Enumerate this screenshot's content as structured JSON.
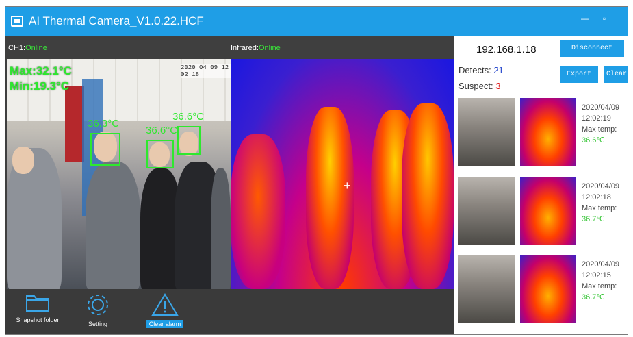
{
  "window": {
    "title": "AI Thermal Camera_V1.0.22.HCF",
    "minimize": "—",
    "maximize": "▫"
  },
  "channels": {
    "ch1_label": "CH1:",
    "ch1_status": "Online",
    "ir_label": "Infrared:",
    "ir_status": "Online"
  },
  "camera": {
    "max_label": "Max:32.1°C",
    "min_label": "Min:19.3°C",
    "timestamp": "2020 04 09 12 02 18",
    "detections": [
      "36.3°C",
      "36.6°C",
      "36.6°C"
    ]
  },
  "toolbar": {
    "snapshot_folder": "Snapshot folder",
    "setting": "Setting",
    "clear_alarm": "Clear alarm"
  },
  "panel": {
    "ip": "192.168.1.18",
    "disconnect": "Disconnect",
    "export": "Export",
    "clear": "Clear",
    "detects_label": "Detects: ",
    "detects_value": "21",
    "suspect_label": "Suspect: ",
    "suspect_value": "3"
  },
  "records": [
    {
      "date": "2020/04/09",
      "time": "12:02:19",
      "label": "Max temp:",
      "temp": "36.6℃"
    },
    {
      "date": "2020/04/09",
      "time": "12:02:18",
      "label": "Max temp:",
      "temp": "36.7℃"
    },
    {
      "date": "2020/04/09",
      "time": "12:02:15",
      "label": "Max temp:",
      "temp": "36.7℃"
    }
  ],
  "colors": {
    "accent": "#1f9ee6",
    "online": "#39e639",
    "bbox": "#2ee82e",
    "suspect": "#dd1111",
    "detects": "#2244cc"
  }
}
